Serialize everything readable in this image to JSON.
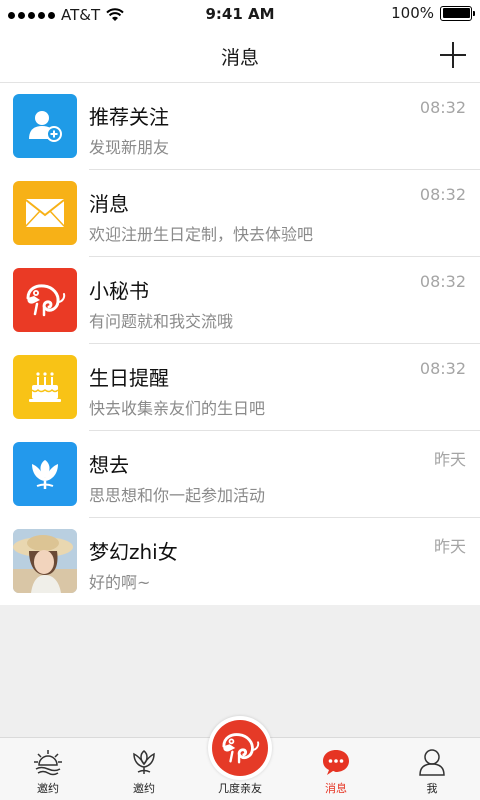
{
  "status_bar": {
    "carrier": "AT&T",
    "time": "9:41 AM",
    "battery": "100%"
  },
  "nav": {
    "title": "消息"
  },
  "messages": [
    {
      "title": "推荐关注",
      "subtitle": "发现新朋友",
      "time": "08:32",
      "icon": "add-user-icon",
      "color": "#1f9be7"
    },
    {
      "title": "消息",
      "subtitle": "欢迎注册生日定制，快去体验吧",
      "time": "08:32",
      "icon": "envelope-icon",
      "color": "#f7b117"
    },
    {
      "title": "小秘书",
      "subtitle": "有问题就和我交流哦",
      "time": "08:32",
      "icon": "chameleon-icon",
      "color": "#ea3a25"
    },
    {
      "title": "生日提醒",
      "subtitle": "快去收集亲友们的生日吧",
      "time": "08:32",
      "icon": "cake-icon",
      "color": "#f8c316"
    },
    {
      "title": "想去",
      "subtitle": "思思想和你一起参加活动",
      "time": "昨天",
      "icon": "tulip-icon",
      "color": "#2399ec"
    },
    {
      "title": "梦幻zhi女",
      "subtitle": "好的啊~",
      "time": "昨天",
      "icon": "user-photo",
      "color": "#c9a98a"
    }
  ],
  "tabs": [
    {
      "label": "邀约",
      "icon": "sun-icon"
    },
    {
      "label": "邀约",
      "icon": "tulip-outline-icon"
    },
    {
      "label": "几度亲友",
      "icon": "chameleon-icon"
    },
    {
      "label": "消息",
      "icon": "chat-bubble-icon"
    },
    {
      "label": "我",
      "icon": "person-icon"
    }
  ],
  "colors": {
    "accent": "#e63423",
    "background": "#efefef"
  }
}
